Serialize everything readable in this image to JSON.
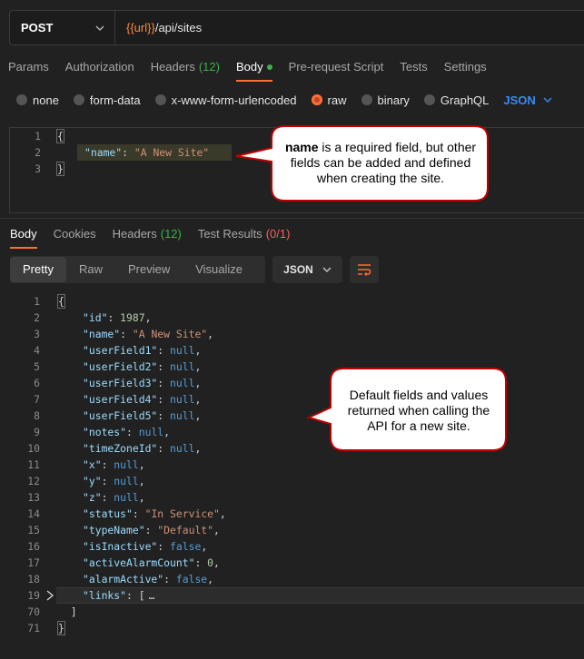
{
  "request": {
    "method": "POST",
    "url_var": "{{url}}",
    "url_path": "/api/sites"
  },
  "req_tabs": [
    {
      "label": "Params"
    },
    {
      "label": "Authorization"
    },
    {
      "label": "Headers",
      "count": "(12)"
    },
    {
      "label": "Body",
      "active": true
    },
    {
      "label": "Pre-request Script"
    },
    {
      "label": "Tests"
    },
    {
      "label": "Settings"
    }
  ],
  "body_types": [
    "none",
    "form-data",
    "x-www-form-urlencoded",
    "raw",
    "binary",
    "GraphQL"
  ],
  "body_type_selected": "raw",
  "body_lang": "JSON",
  "req_body_lines": [
    "1",
    "2",
    "3"
  ],
  "req_body": {
    "open": "{",
    "key": "\"name\"",
    "value": "\"A New Site\"",
    "close": "}"
  },
  "resp_tabs": {
    "body": "Body",
    "cookies": "Cookies",
    "headers": "Headers",
    "headers_count": "(12)",
    "tests": "Test Results",
    "tests_count": "(0/1)"
  },
  "view_modes": [
    "Pretty",
    "Raw",
    "Preview",
    "Visualize"
  ],
  "resp_format": "JSON",
  "response_lines": [
    {
      "ln": "1",
      "text": "{"
    },
    {
      "ln": "2",
      "key": "\"id\"",
      "val": "1987",
      "type": "n",
      "comma": ","
    },
    {
      "ln": "3",
      "key": "\"name\"",
      "val": "\"A New Site\"",
      "type": "s",
      "comma": ","
    },
    {
      "ln": "4",
      "key": "\"userField1\"",
      "val": "null",
      "type": "kw",
      "comma": ","
    },
    {
      "ln": "5",
      "key": "\"userField2\"",
      "val": "null",
      "type": "kw",
      "comma": ","
    },
    {
      "ln": "6",
      "key": "\"userField3\"",
      "val": "null",
      "type": "kw",
      "comma": ","
    },
    {
      "ln": "7",
      "key": "\"userField4\"",
      "val": "null",
      "type": "kw",
      "comma": ","
    },
    {
      "ln": "8",
      "key": "\"userField5\"",
      "val": "null",
      "type": "kw",
      "comma": ","
    },
    {
      "ln": "9",
      "key": "\"notes\"",
      "val": "null",
      "type": "kw",
      "comma": ","
    },
    {
      "ln": "10",
      "key": "\"timeZoneId\"",
      "val": "null",
      "type": "kw",
      "comma": ","
    },
    {
      "ln": "11",
      "key": "\"x\"",
      "val": "null",
      "type": "kw",
      "comma": ","
    },
    {
      "ln": "12",
      "key": "\"y\"",
      "val": "null",
      "type": "kw",
      "comma": ","
    },
    {
      "ln": "13",
      "key": "\"z\"",
      "val": "null",
      "type": "kw",
      "comma": ","
    },
    {
      "ln": "14",
      "key": "\"status\"",
      "val": "\"In Service\"",
      "type": "s",
      "comma": ","
    },
    {
      "ln": "15",
      "key": "\"typeName\"",
      "val": "\"Default\"",
      "type": "s",
      "comma": ","
    },
    {
      "ln": "16",
      "key": "\"isInactive\"",
      "val": "false",
      "type": "kw",
      "comma": ","
    },
    {
      "ln": "17",
      "key": "\"activeAlarmCount\"",
      "val": "0",
      "type": "n",
      "comma": ","
    },
    {
      "ln": "18",
      "key": "\"alarmActive\"",
      "val": "false",
      "type": "kw",
      "comma": ","
    },
    {
      "ln": "19",
      "key": "\"links\"",
      "val": "[",
      "type": "p",
      "folded": "…",
      "collapsed": true
    },
    {
      "ln": "70",
      "text": "  ]"
    },
    {
      "ln": "71",
      "text": "}"
    }
  ],
  "callouts": {
    "request": {
      "bold": "name",
      "text": " is a required field, but other fields can be added and defined when creating the site."
    },
    "response": {
      "text": "Default fields and values returned when calling the API for a new site."
    }
  },
  "colors": {
    "accent": "#ff6c37",
    "success": "#3fb04a",
    "error": "#ff5f5f",
    "link": "#3a8bf5",
    "callout_border": "#c00000"
  }
}
